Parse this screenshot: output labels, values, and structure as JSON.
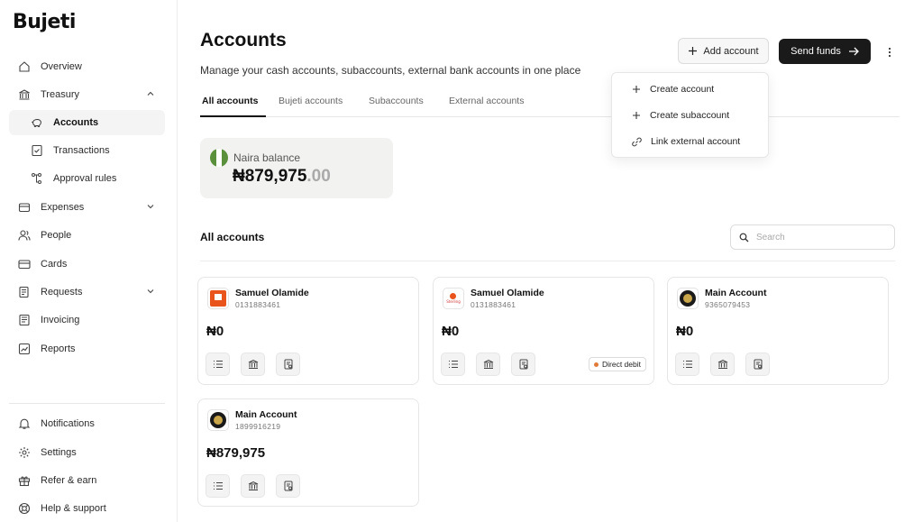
{
  "app": {
    "logo_text": "Bujeti"
  },
  "sidebar": {
    "items": [
      {
        "label": "Overview",
        "icon": "home-icon"
      },
      {
        "label": "Treasury",
        "icon": "bank-icon"
      },
      {
        "label": "Accounts",
        "icon": "piggy-bank-icon"
      },
      {
        "label": "Transactions",
        "icon": "receipt-icon"
      },
      {
        "label": "Approval rules",
        "icon": "flow-icon"
      },
      {
        "label": "Expenses",
        "icon": "wallet-icon"
      },
      {
        "label": "People",
        "icon": "people-icon"
      },
      {
        "label": "Cards",
        "icon": "card-icon"
      },
      {
        "label": "Requests",
        "icon": "document-icon"
      },
      {
        "label": "Invoicing",
        "icon": "invoice-icon"
      },
      {
        "label": "Reports",
        "icon": "chart-icon"
      }
    ],
    "footer": [
      {
        "label": "Notifications",
        "icon": "bell-icon"
      },
      {
        "label": "Settings",
        "icon": "gear-icon"
      },
      {
        "label": "Refer & earn",
        "icon": "gift-icon"
      },
      {
        "label": "Help & support",
        "icon": "lifebuoy-icon"
      }
    ]
  },
  "header": {
    "title": "Accounts",
    "subtitle": "Manage your cash accounts, subaccounts, external bank accounts in one place",
    "add_button": "Add account",
    "send_button": "Send funds"
  },
  "tabs": [
    "All accounts",
    "Bujeti accounts",
    "Subaccounts",
    "External accounts"
  ],
  "balance": {
    "label": "Naira balance",
    "whole": "₦879,975",
    "decimal": ".00"
  },
  "section": {
    "title": "All accounts",
    "search_placeholder": "Search"
  },
  "accounts": [
    {
      "name": "Samuel Olamide",
      "number": "0131883461",
      "amount": "₦0",
      "bank": "GTBank",
      "badge": ""
    },
    {
      "name": "Samuel Olamide",
      "number": "0131883461",
      "amount": "₦0",
      "bank": "Sterling",
      "badge": "Direct debit"
    },
    {
      "name": "Main Account",
      "number": "9365079453",
      "amount": "₦0",
      "bank": "Bujeti",
      "badge": ""
    },
    {
      "name": "Main Account",
      "number": "1899916219",
      "amount": "₦879,975",
      "bank": "Bujeti",
      "badge": ""
    }
  ],
  "dropdown": {
    "items": [
      "Create account",
      "Create subaccount",
      "Link external account"
    ]
  },
  "colors": {
    "primary_button": "#1a1a1a",
    "gtbank": "#e8541c",
    "sterling": "#e8541c",
    "badge_dot": "#e07b39",
    "flag_green": "#5a8f3c"
  }
}
